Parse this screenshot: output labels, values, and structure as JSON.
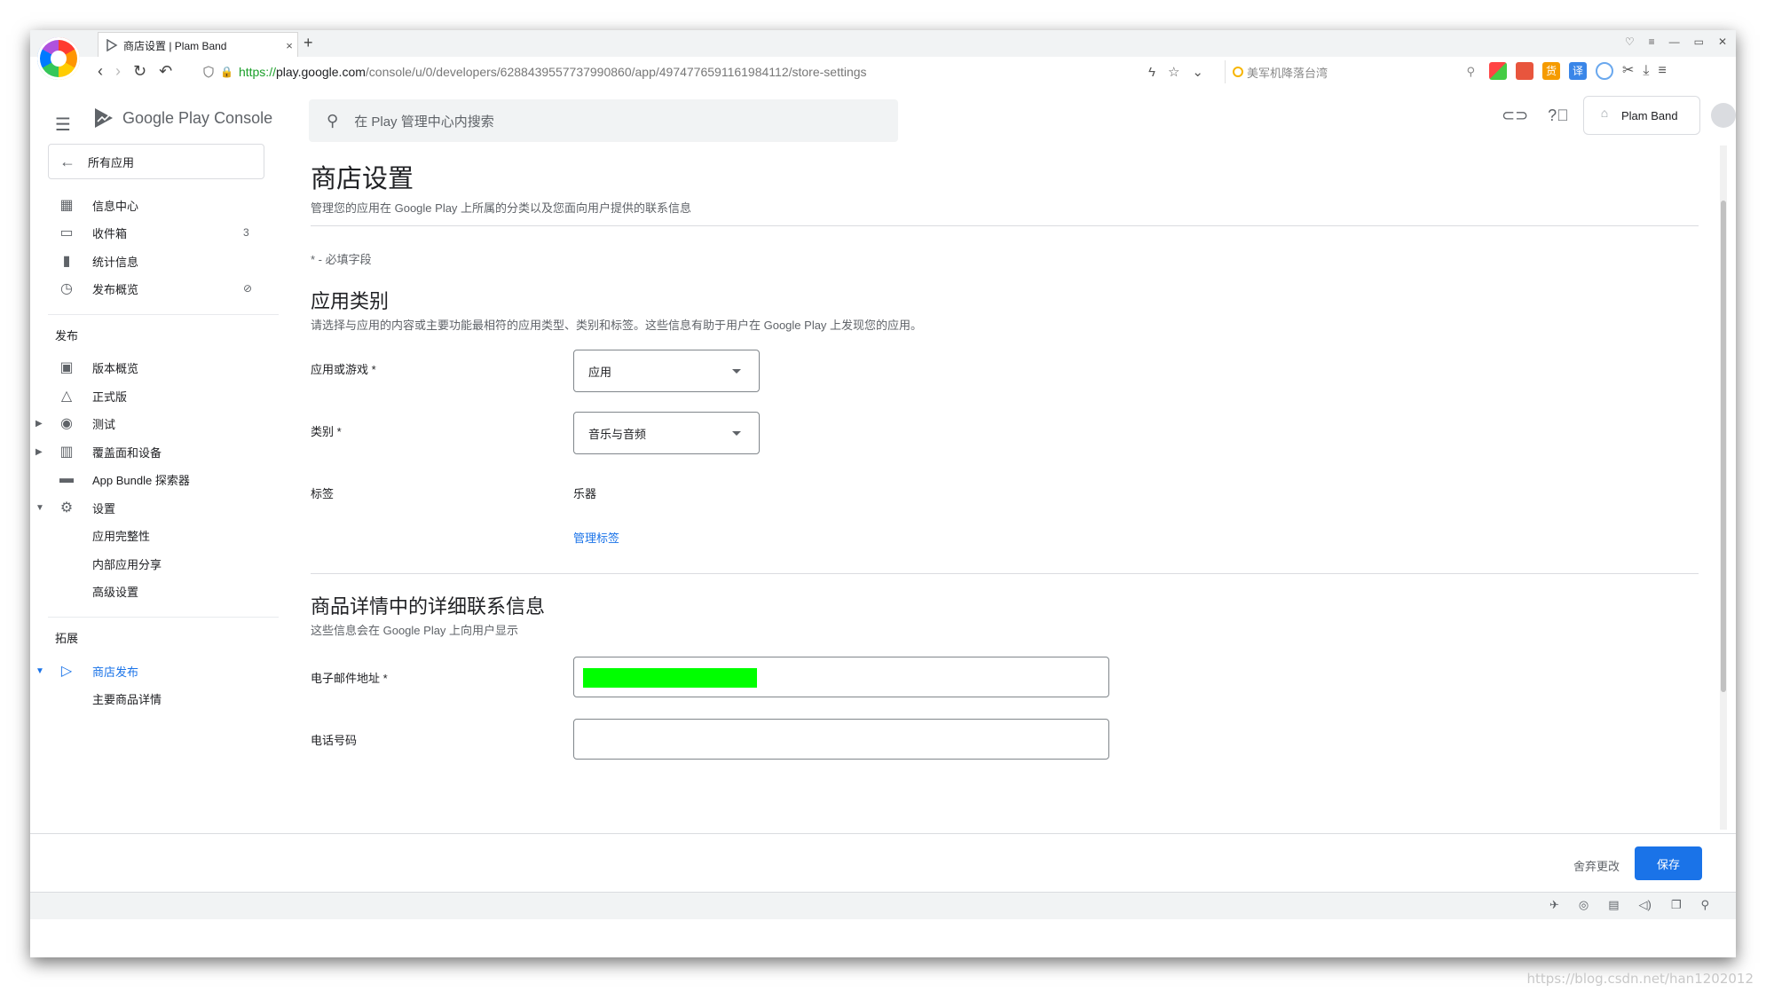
{
  "browser": {
    "tab_title": "商店设置 | Plam Band",
    "close": "×",
    "new_tab": "+",
    "url_scheme": "https://",
    "url_host": "play.google.com",
    "url_path": "/console/u/0/developers/6288439557737990860/app/4974776591161984112/store-settings",
    "search_box": "美军机降落台湾",
    "ext_labels": [
      "",
      "",
      "货",
      "译",
      "",
      "",
      "",
      ""
    ]
  },
  "sidebar": {
    "brand_google": "Google Play",
    "brand_console": "Console",
    "all_apps": "所有应用",
    "items": [
      {
        "label": "信息中心"
      },
      {
        "label": "收件箱",
        "badge": "3"
      },
      {
        "label": "统计信息"
      },
      {
        "label": "发布概览"
      }
    ],
    "release_heading": "发布",
    "release_items": [
      {
        "label": "版本概览"
      },
      {
        "label": "正式版"
      },
      {
        "label": "测试"
      },
      {
        "label": "覆盖面和设备"
      },
      {
        "label": "App Bundle 探索器"
      },
      {
        "label": "设置"
      },
      {
        "label": "应用完整性"
      },
      {
        "label": "内部应用分享"
      },
      {
        "label": "高级设置"
      }
    ],
    "grow_heading": "拓展",
    "grow_items": [
      {
        "label": "商店发布"
      },
      {
        "label": "主要商品详情"
      }
    ]
  },
  "topbar": {
    "search_placeholder": "在 Play 管理中心内搜索",
    "account": "Plam Band"
  },
  "page": {
    "title": "商店设置",
    "subtitle": "管理您的应用在 Google Play 上所属的分类以及您面向用户提供的联系信息",
    "required_note": "* - 必填字段",
    "category_section": {
      "title": "应用类别",
      "desc": "请选择与应用的内容或主要功能最相符的应用类型、类别和标签。这些信息有助于用户在 Google Play 上发现您的应用。",
      "app_or_game_label": "应用或游戏 *",
      "app_or_game_value": "应用",
      "category_label": "类别 *",
      "category_value": "音乐与音频",
      "tags_label": "标签",
      "tags_value": "乐器",
      "manage_tags": "管理标签"
    },
    "contact_section": {
      "title": "商品详情中的详细联系信息",
      "desc": "这些信息会在 Google Play 上向用户显示",
      "email_label": "电子邮件地址 *",
      "phone_label": "电话号码"
    }
  },
  "footer": {
    "discard": "舍弃更改",
    "save": "保存"
  },
  "watermark": "https://blog.csdn.net/han1202012",
  "colors": {
    "accent": "#1a73e8",
    "redaction": "#00ff00"
  }
}
